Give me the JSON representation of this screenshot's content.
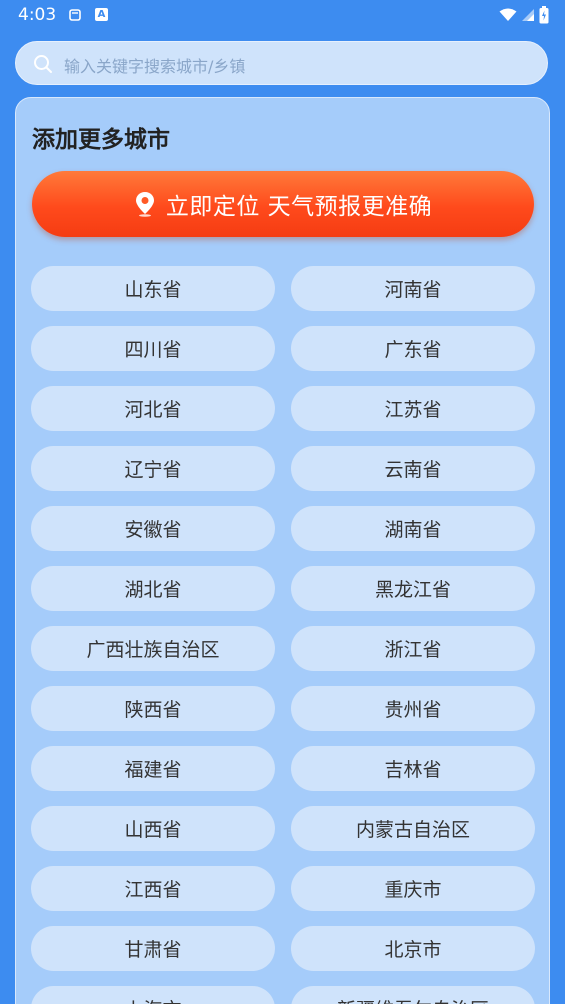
{
  "status_bar": {
    "time": "4:03"
  },
  "search": {
    "placeholder": "输入关键字搜索城市/乡镇"
  },
  "card": {
    "title": "添加更多城市",
    "locate_label": "立即定位 天气预报更准确"
  },
  "provinces": [
    "山东省",
    "河南省",
    "四川省",
    "广东省",
    "河北省",
    "江苏省",
    "辽宁省",
    "云南省",
    "安徽省",
    "湖南省",
    "湖北省",
    "黑龙江省",
    "广西壮族自治区",
    "浙江省",
    "陕西省",
    "贵州省",
    "福建省",
    "吉林省",
    "山西省",
    "内蒙古自治区",
    "江西省",
    "重庆市",
    "甘肃省",
    "北京市",
    "上海市",
    "新疆维吾尔自治区"
  ],
  "colors": {
    "background": "#3d8cf0",
    "card": "#a5ccfa",
    "pill": "#cfe3fb",
    "locate_button": "#ff4a1c"
  },
  "icons": {
    "search": "search-icon",
    "locate": "location-pin-icon",
    "wifi": "wifi-icon",
    "signal": "signal-icon",
    "battery": "battery-icon"
  }
}
